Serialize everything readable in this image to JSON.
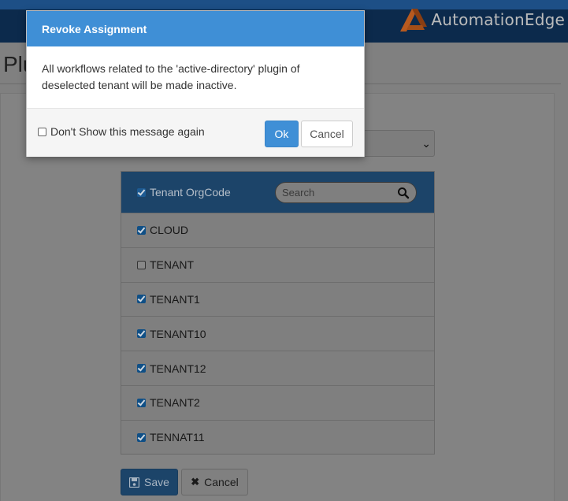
{
  "header": {
    "brand_text": "AutomationEdge",
    "brand_color": "#e36b22"
  },
  "page": {
    "title_partial": "Plu"
  },
  "table": {
    "header_label": "Tenant OrgCode",
    "header_checked": true,
    "search_placeholder": "Search",
    "rows": [
      {
        "label": "CLOUD",
        "checked": true
      },
      {
        "label": "TENANT",
        "checked": false
      },
      {
        "label": "TENANT1",
        "checked": true
      },
      {
        "label": "TENANT10",
        "checked": true
      },
      {
        "label": "TENANT12",
        "checked": true
      },
      {
        "label": "TENANT2",
        "checked": true
      },
      {
        "label": "TENNAT11",
        "checked": true
      }
    ]
  },
  "actions": {
    "save_label": "Save",
    "cancel_label": "Cancel"
  },
  "modal": {
    "title": "Revoke Assignment",
    "message_line1": "All workflows related to the 'active-directory' plugin of",
    "message_line2": "deselected tenant will be made inactive.",
    "dont_show_label": "Don't Show this message again",
    "ok_label": "Ok",
    "cancel_label": "Cancel",
    "accent_color": "#3f8fd6"
  }
}
